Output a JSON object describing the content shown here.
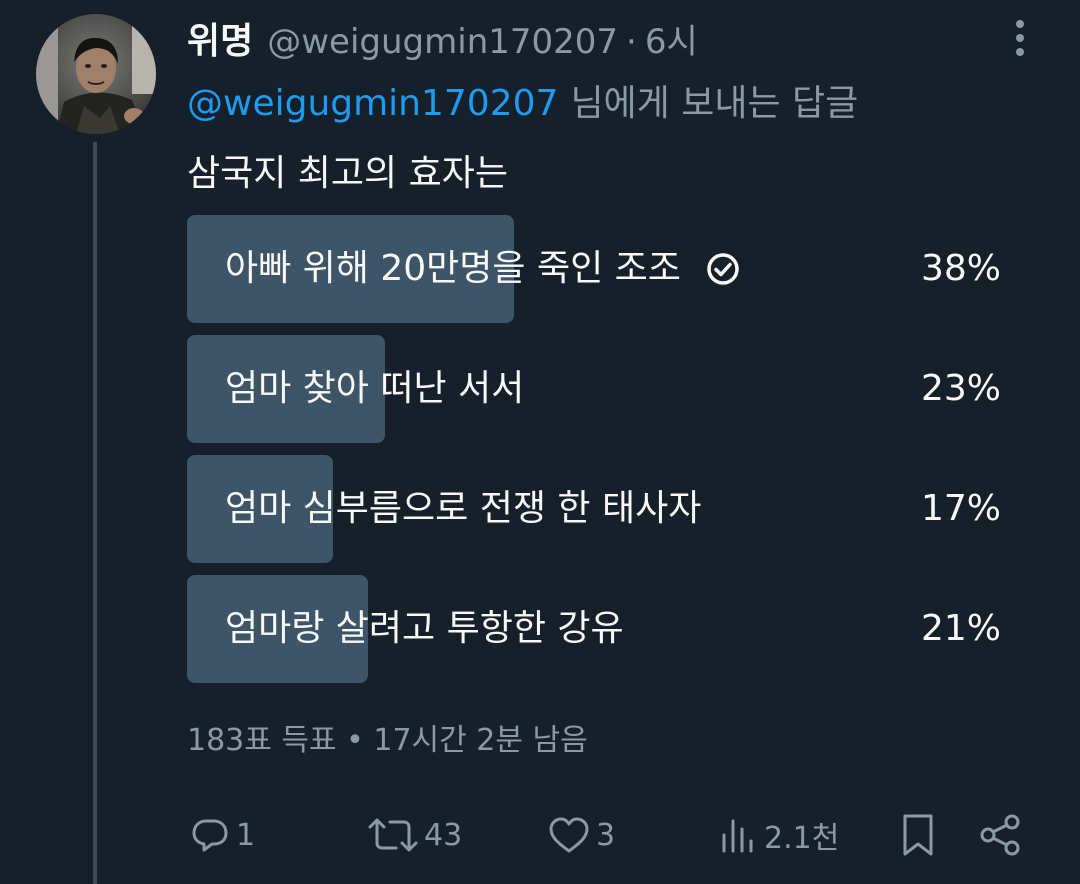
{
  "tweet": {
    "display_name": "위명",
    "handle": "@weigugmin170207",
    "separator": "·",
    "time": "6시",
    "reply_to_handle": "@weigugmin170207",
    "reply_to_suffix": "님에게 보내는 답글",
    "text": "삼국지 최고의 효자는"
  },
  "poll": {
    "options": [
      {
        "label": "아빠 위해 20만명을 죽인 조조",
        "percent_text": "38%",
        "percent": 38,
        "voted": true
      },
      {
        "label": "엄마 찾아 떠난 서서",
        "percent_text": "23%",
        "percent": 23,
        "voted": false
      },
      {
        "label": "엄마 심부름으로 전쟁 한 태사자",
        "percent_text": "17%",
        "percent": 17,
        "voted": false
      },
      {
        "label": "엄마랑 살려고 투항한 강유",
        "percent_text": "21%",
        "percent": 21,
        "voted": false
      }
    ],
    "meta": "183표 득표 • 17시간 2분 남음"
  },
  "actions": {
    "reply_count": "1",
    "retweet_count": "43",
    "like_count": "3",
    "view_count": "2.1천"
  },
  "icons": {
    "more": "more-vertical-icon",
    "reply": "reply-icon",
    "retweet": "retweet-icon",
    "like": "heart-icon",
    "views": "views-chart-icon",
    "bookmark": "bookmark-icon",
    "share": "share-icon",
    "voted": "check-circle-icon"
  },
  "colors": {
    "background": "#15202b",
    "text": "#f7f9f9",
    "secondary": "#8b98a5",
    "link": "#1d9bf0",
    "poll_bar": "#3e5467"
  }
}
